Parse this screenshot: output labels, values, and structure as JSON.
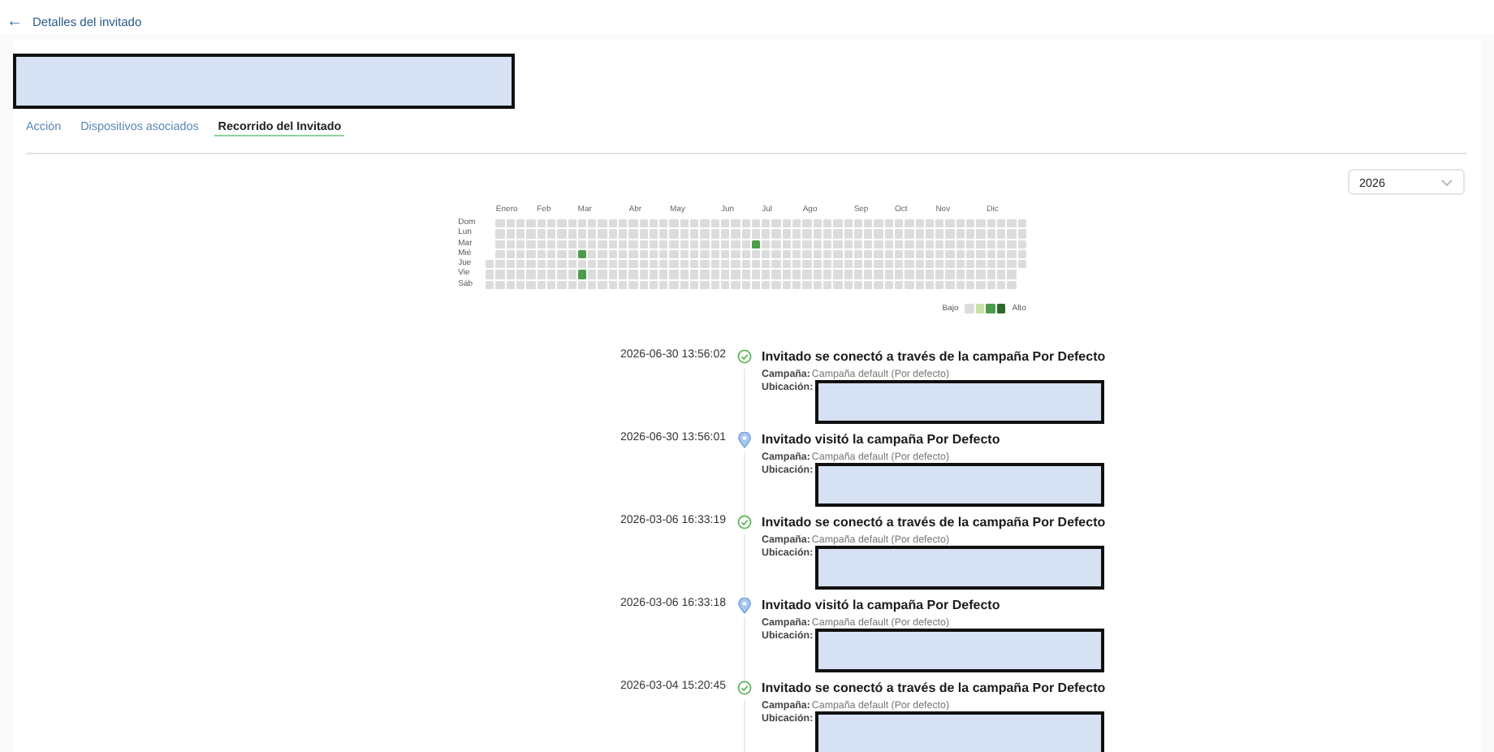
{
  "header": {
    "back_icon": "←",
    "title": "Detalles del invitado"
  },
  "guest_name": {
    "redacted": true
  },
  "tabs": [
    {
      "label": "Acción",
      "selected": false
    },
    {
      "label": "Dispositivos asociados",
      "selected": false
    },
    {
      "label": "Recorrido del Invitado",
      "selected": true
    }
  ],
  "year_select": {
    "value": "2026"
  },
  "heatmap": {
    "months": [
      "Enero",
      "Feb",
      "Mar",
      "Abr",
      "May",
      "Jun",
      "Jul",
      "Ago",
      "Sep",
      "Oct",
      "Nov",
      "Dic"
    ],
    "days": [
      "Dom",
      "Lun",
      "Mar",
      "Mié",
      "Jue",
      "Vie",
      "Sáb"
    ],
    "legend": {
      "low": "Bajo",
      "high": "Alto"
    }
  },
  "timeline": [
    {
      "timestamp": "2026-06-30 13:56:02",
      "kind": "connected",
      "title": "Invitado se conectó a través de la campaña Por Defecto",
      "campaign_label": "Campaña:",
      "campaign": "Campaña default (Por defecto)",
      "location_label": "Ubicación:",
      "location_redacted": true
    },
    {
      "timestamp": "2026-06-30 13:56:01",
      "kind": "visited",
      "title": "Invitado visitó la campaña Por Defecto",
      "campaign_label": "Campaña:",
      "campaign": "Campaña default (Por defecto)",
      "location_label": "Ubicación:",
      "location_redacted": true
    },
    {
      "timestamp": "2026-03-06 16:33:19",
      "kind": "connected",
      "title": "Invitado se conectó a través de la campaña Por Defecto",
      "campaign_label": "Campaña:",
      "campaign": "Campaña default (Por defecto)",
      "location_label": "Ubicación:",
      "location_redacted": true
    },
    {
      "timestamp": "2026-03-06 16:33:18",
      "kind": "visited",
      "title": "Invitado visitó la campaña Por Defecto",
      "campaign_label": "Campaña:",
      "campaign": "Campaña default (Por defecto)",
      "location_label": "Ubicación:",
      "location_redacted": true
    },
    {
      "timestamp": "2026-03-04 15:20:45",
      "kind": "connected",
      "title": "Invitado se conectó a través de la campaña Por Defecto",
      "campaign_label": "Campaña:",
      "campaign": "Campaña default (Por defecto)",
      "location_label": "Ubicación:",
      "location_redacted": true
    }
  ]
}
